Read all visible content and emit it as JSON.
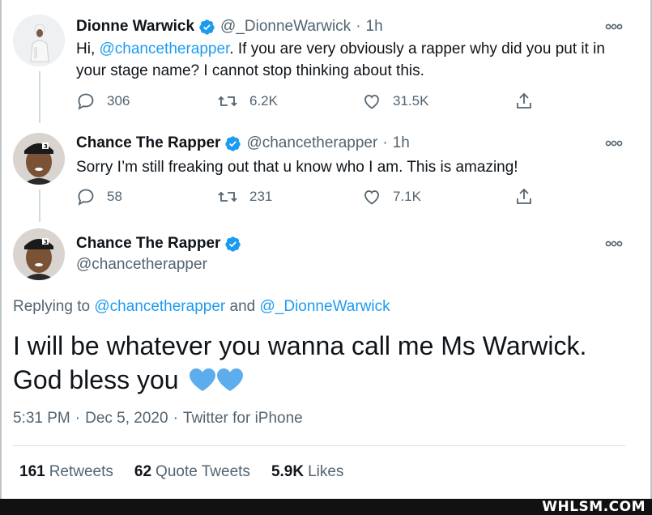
{
  "tweets": [
    {
      "name": "Dionne Warwick",
      "handle": "@_DionneWarwick",
      "time": "1h",
      "text_before": "Hi, ",
      "mention": "@chancetherapper",
      "text_after": ". If you are very obviously a rapper why did you put it in your stage name? I cannot stop thinking about this.",
      "replies": "306",
      "retweets": "6.2K",
      "likes": "31.5K"
    },
    {
      "name": "Chance The Rapper",
      "handle": "@chancetherapper",
      "time": "1h",
      "text": "Sorry I’m still freaking out that u know who I am. This is amazing!",
      "replies": "58",
      "retweets": "231",
      "likes": "7.1K"
    }
  ],
  "main_tweet": {
    "name": "Chance The Rapper",
    "handle": "@chancetherapper",
    "replying_prefix": "Replying to ",
    "replying_user1": "@chancetherapper",
    "replying_and": " and ",
    "replying_user2": "@_DionneWarwick",
    "text": "I will be whatever you wanna call me Ms Warwick. God bless you",
    "emoji": "blue-heart-icon x2",
    "time": "5:31 PM",
    "date": "Dec 5, 2020",
    "source": "Twitter for iPhone",
    "retweets_count": "161",
    "retweets_label": "Retweets",
    "quotes_count": "62",
    "quotes_label": "Quote Tweets",
    "likes_count": "5.9K",
    "likes_label": "Likes"
  },
  "watermark": "WHLSM.COM",
  "colors": {
    "accent": "#1d9bf0",
    "muted": "#536471",
    "heart_blue": "#5dadec"
  }
}
